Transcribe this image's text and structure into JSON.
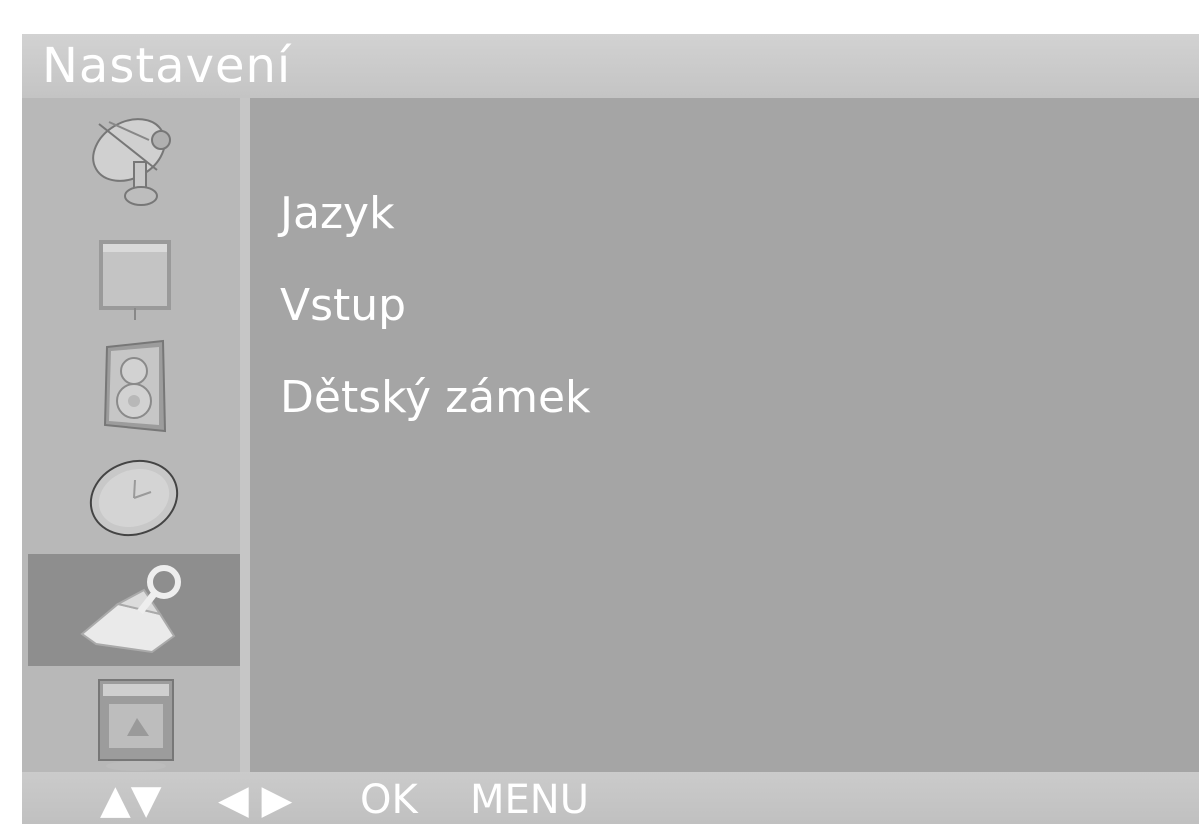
{
  "menu": {
    "title": "Nastavení"
  },
  "categories": [
    {
      "icon": "satellite-dish-icon"
    },
    {
      "icon": "picture-icon"
    },
    {
      "icon": "speaker-icon"
    },
    {
      "icon": "clock-icon"
    },
    {
      "icon": "wrench-icon",
      "selected": true
    },
    {
      "icon": "screen-icon"
    }
  ],
  "items": [
    {
      "label": "Jazyk"
    },
    {
      "label": "Vstup"
    },
    {
      "label": "Dětský zámek"
    }
  ],
  "hints": {
    "up_down": "▲▼",
    "left_right": "◀ ▶",
    "ok": "OK",
    "menu": "MENU"
  },
  "colors": {
    "title_bar": "#c8c8c8",
    "sidebar": "#b8b8b8",
    "content": "#a5a5a5",
    "selected": "#8e8e8e",
    "text": "#ffffff"
  }
}
